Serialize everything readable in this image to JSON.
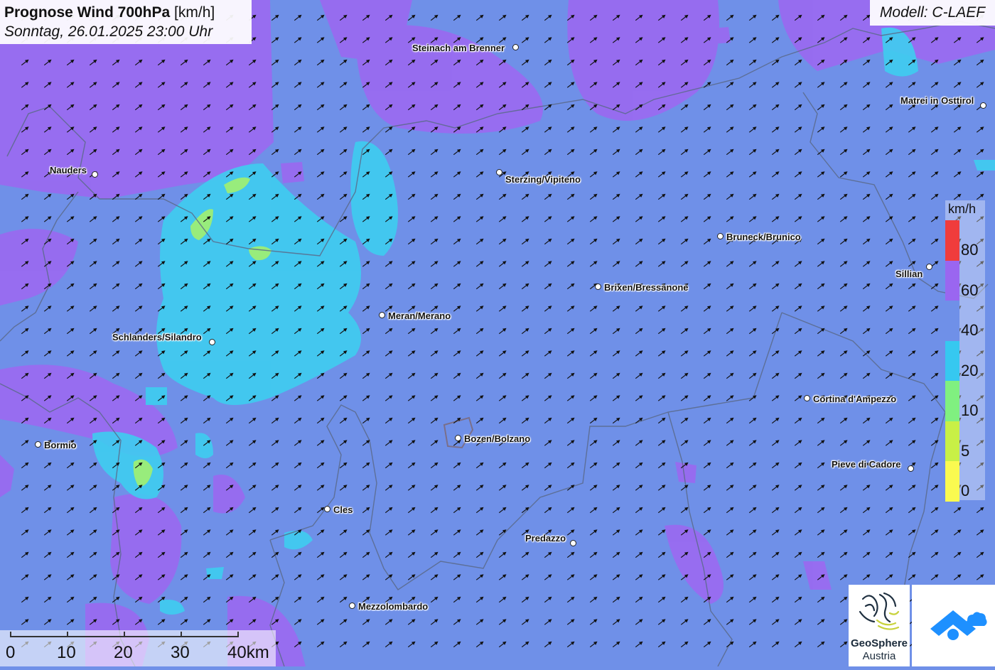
{
  "header": {
    "title_bold": "Prognose Wind 700hPa",
    "title_unit": " [km/h]",
    "subtitle": "Sonntag, 26.01.2025 23:00 Uhr"
  },
  "model": {
    "label": "Modell: C-LAEF"
  },
  "legend": {
    "unit": "km/h",
    "labels": [
      "80",
      "60",
      "40",
      "20",
      "10",
      "5",
      "0"
    ],
    "colors": [
      "#f03c3c",
      "#9a66f0",
      "#6f90e8",
      "#36c8f0",
      "#80f080",
      "#c8f046",
      "#fafa50"
    ]
  },
  "scale": {
    "labels": [
      "0",
      "10",
      "20",
      "30",
      "40km"
    ]
  },
  "logos": {
    "geosphere_name": "GeoSphere",
    "geosphere_sub": "Austria"
  },
  "icons": {
    "wind-arrow": "wind-arrow-icon",
    "logo": "geosphere-logo-icon",
    "brand": "brand-logo-icon"
  },
  "cities": [
    {
      "name": "Steinach am Brenner"
    },
    {
      "name": "Matrei in Osttirol"
    },
    {
      "name": "Nauders"
    },
    {
      "name": "Sterzing/Vipiteno"
    },
    {
      "name": "Bruneck/Brunico"
    },
    {
      "name": "Sillian"
    },
    {
      "name": "Brixen/Bressanone"
    },
    {
      "name": "Meran/Merano"
    },
    {
      "name": "Schlanders/Silandro"
    },
    {
      "name": "Cortina d'Ampezzo"
    },
    {
      "name": "Bormio"
    },
    {
      "name": "Bozen/Bolzano"
    },
    {
      "name": "Pieve di Cadore"
    },
    {
      "name": "Cles"
    },
    {
      "name": "Predazzo"
    },
    {
      "name": "Mezzolombardo"
    }
  ]
}
